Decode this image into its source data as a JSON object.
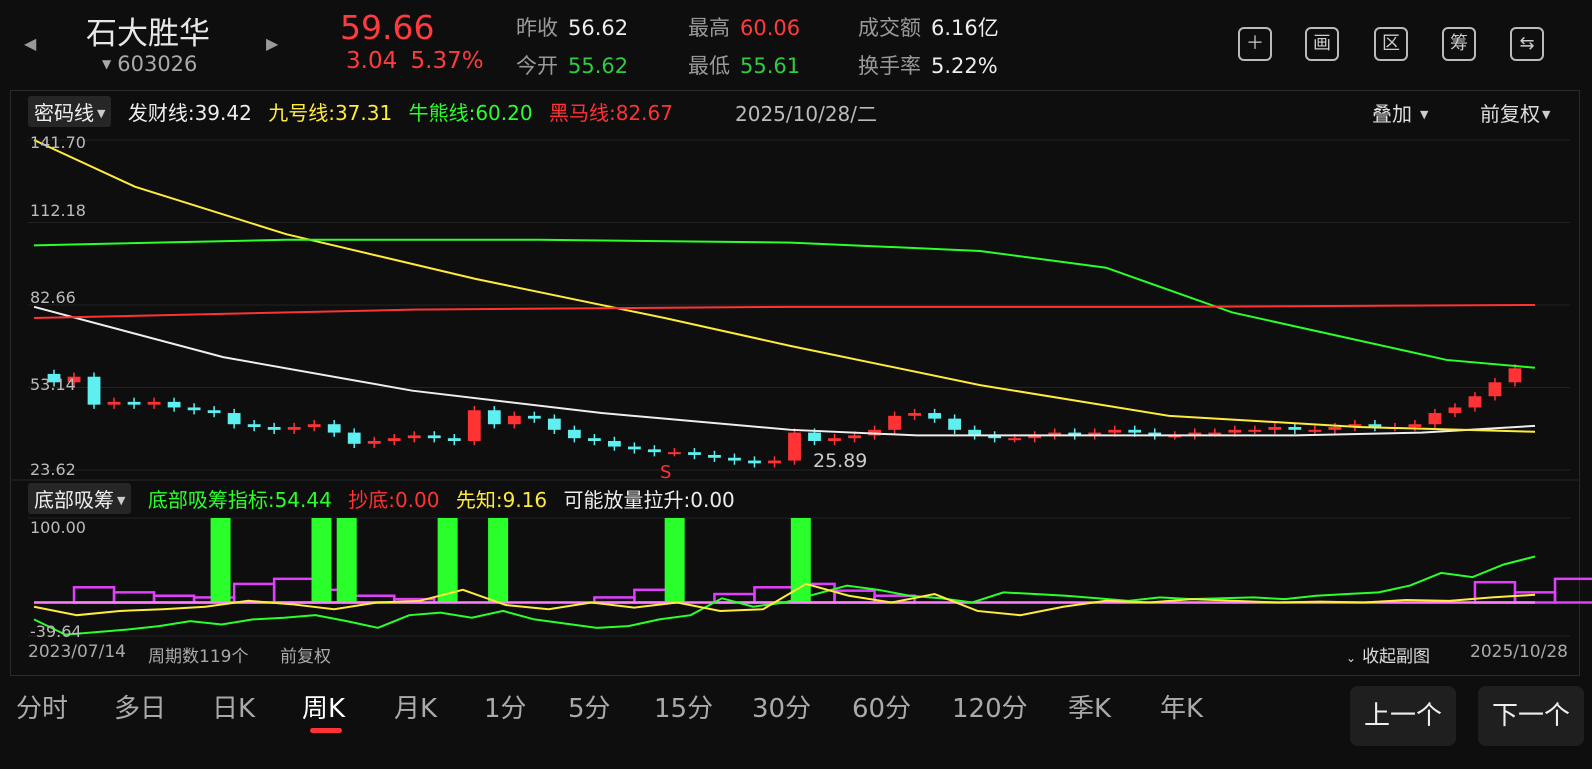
{
  "header": {
    "name": "石大胜华",
    "code": "603026",
    "price": "59.66",
    "change": "3.04",
    "change_pct": "5.37%",
    "quotes": {
      "prev_close_label": "昨收",
      "prev_close": "56.62",
      "open_label": "今开",
      "open": "55.62",
      "high_label": "最高",
      "high": "60.06",
      "low_label": "最低",
      "low": "55.61",
      "amount_label": "成交额",
      "amount": "6.16亿",
      "turnover_label": "换手率",
      "turnover": "5.22%"
    },
    "icons": [
      "plus-icon",
      "draw-icon",
      "zone-icon",
      "chip-icon",
      "switch-device-icon"
    ],
    "icon_glyphs": [
      "＋",
      "画",
      "区",
      "筹",
      "⇆"
    ]
  },
  "main_chart": {
    "selector": "密码线",
    "indicators": [
      {
        "label": "发财线:",
        "value": "39.42",
        "color": "#eeeeee"
      },
      {
        "label": "九号线:",
        "value": "37.31",
        "color": "#ffeb3b"
      },
      {
        "label": "牛熊线:",
        "value": "60.20",
        "color": "#2bff2b"
      },
      {
        "label": "黑马线:",
        "value": "82.67",
        "color": "#ff3333"
      }
    ],
    "date": "2025/10/28/二",
    "overlay": "叠加",
    "adjust": "前复权",
    "y_labels": [
      "141.70",
      "112.18",
      "82.66",
      "53.14",
      "23.62"
    ],
    "low_marker": "25.89",
    "signal_mark": "S"
  },
  "sub_chart": {
    "selector": "底部吸筹",
    "indicators": [
      {
        "label": "底部吸筹指标:",
        "value": "54.44",
        "color": "#2bff2b"
      },
      {
        "label": "抄底:",
        "value": "0.00",
        "color": "#ff3333"
      },
      {
        "label": "先知:",
        "value": "9.16",
        "color": "#ffeb3b"
      },
      {
        "label": "可能放量拉升:",
        "value": "0.00",
        "color": "#eeeeee"
      }
    ],
    "y_top": "100.00",
    "y_bottom": "-39.64"
  },
  "footer": {
    "start_date": "2023/07/14",
    "period_count": "周期数119个",
    "adjust": "前复权",
    "collapse": "收起副图",
    "end_date": "2025/10/28"
  },
  "tabs": [
    "分时",
    "多日",
    "日K",
    "周K",
    "月K",
    "1分",
    "5分",
    "15分",
    "30分",
    "60分",
    "120分",
    "季K",
    "年K"
  ],
  "active_tab": "周K",
  "buttons": {
    "prev": "上一个",
    "next": "下一个"
  },
  "colors": {
    "up": "#ff3333",
    "down": "#5ef0f0",
    "bull_bear": "#2bff2b",
    "nine": "#ffeb3b",
    "dark_horse": "#ff3333",
    "fortune": "#eeeeee",
    "accumulate": "#2bff2b",
    "magenta": "#e040fb"
  },
  "chart_data": [
    {
      "type": "candlestick",
      "title": "密码线",
      "ylim": [
        23.62,
        141.7
      ],
      "period": "weekly",
      "x_range": [
        "2023/07/14",
        "2025/10/28"
      ],
      "bars": 119,
      "close_path": [
        58,
        55,
        57,
        47,
        48,
        47,
        48,
        46,
        45,
        44,
        40,
        39,
        38,
        39,
        40,
        37,
        33,
        34,
        35,
        36,
        35,
        34,
        45,
        40,
        43,
        42,
        38,
        35,
        34,
        32,
        31,
        30,
        30,
        29,
        28,
        27,
        26,
        27,
        37,
        34,
        35,
        36,
        38,
        43,
        44,
        42,
        38,
        36,
        35,
        35,
        36,
        37,
        36,
        37,
        38,
        37,
        36,
        36,
        37,
        37,
        38,
        38,
        39,
        38,
        38,
        39,
        40,
        39,
        39,
        40,
        44,
        46,
        50,
        55,
        60
      ],
      "lines": [
        {
          "name": "发财线",
          "color": "#eeeeee",
          "points": [
            [
              0,
              82
            ],
            [
              15,
              64
            ],
            [
              30,
              52
            ],
            [
              45,
              44
            ],
            [
              60,
              38
            ],
            [
              70,
              36
            ],
            [
              85,
              36
            ],
            [
              100,
              36
            ],
            [
              110,
              37
            ],
            [
              119,
              39.42
            ]
          ]
        },
        {
          "name": "九号线",
          "color": "#ffeb3b",
          "points": [
            [
              0,
              141.7
            ],
            [
              8,
              125
            ],
            [
              20,
              108
            ],
            [
              35,
              92
            ],
            [
              50,
              78
            ],
            [
              60,
              68
            ],
            [
              75,
              54
            ],
            [
              90,
              43
            ],
            [
              105,
              39
            ],
            [
              119,
              37.31
            ]
          ]
        },
        {
          "name": "牛熊线",
          "color": "#2bff2b",
          "points": [
            [
              0,
              104
            ],
            [
              20,
              106
            ],
            [
              40,
              106
            ],
            [
              60,
              105
            ],
            [
              75,
              102
            ],
            [
              85,
              96
            ],
            [
              95,
              80
            ],
            [
              105,
              70
            ],
            [
              112,
              63
            ],
            [
              119,
              60.2
            ]
          ]
        },
        {
          "name": "黑马线",
          "color": "#ff3333",
          "points": [
            [
              0,
              78
            ],
            [
              30,
              81
            ],
            [
              60,
              82
            ],
            [
              90,
              82
            ],
            [
              119,
              82.67
            ]
          ]
        }
      ],
      "annotations": [
        {
          "text": "S",
          "bar_index": 33
        },
        {
          "text": "25.89",
          "bar_index": 60
        }
      ]
    },
    {
      "type": "bar+line",
      "title": "底部吸筹",
      "ylim": [
        -39.64,
        100
      ],
      "accumulate_bars_at": [
        14,
        22,
        24,
        32,
        36,
        50,
        60
      ],
      "series": [
        {
          "name": "底部吸筹指标",
          "color": "#2bff2b",
          "values": [
            -20,
            -38,
            -35,
            -32,
            -28,
            -22,
            -26,
            -20,
            -18,
            -15,
            -22,
            -30,
            -15,
            -12,
            -18,
            -10,
            -20,
            -25,
            -30,
            -28,
            -20,
            -15,
            5,
            -5,
            0,
            10,
            20,
            15,
            8,
            5,
            0,
            12,
            10,
            8,
            5,
            2,
            6,
            4,
            5,
            6,
            4,
            8,
            10,
            12,
            20,
            35,
            30,
            45,
            54.44
          ]
        },
        {
          "name": "先知",
          "color": "#ffeb3b",
          "values": [
            -5,
            -15,
            -10,
            -8,
            -5,
            2,
            -2,
            -8,
            0,
            2,
            15,
            -3,
            -8,
            0,
            -6,
            0,
            -10,
            -8,
            22,
            8,
            0,
            10,
            -10,
            -15,
            -5,
            2,
            0,
            4,
            2,
            0,
            1,
            0,
            3,
            2,
            6,
            9.16
          ]
        }
      ]
    }
  ]
}
